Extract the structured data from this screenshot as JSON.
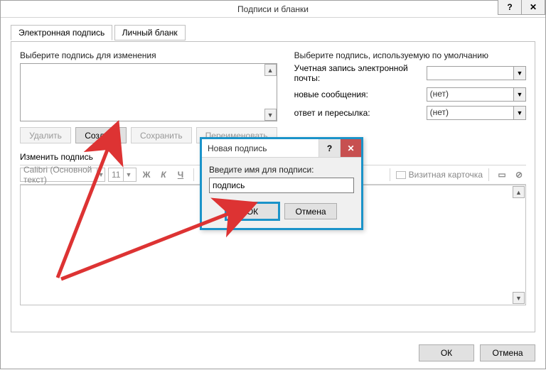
{
  "window": {
    "title": "Подписи и бланки"
  },
  "tabs": {
    "signature": "Электронная подпись",
    "blank": "Личный бланк"
  },
  "left": {
    "select_label": "Выберите подпись для изменения",
    "delete": "Удалить",
    "create": "Создать",
    "save": "Сохранить",
    "rename": "Переименовать"
  },
  "right": {
    "default_label": "Выберите подпись, используемую по умолчанию",
    "account_label": "Учетная запись электронной почты:",
    "account_value": "",
    "new_msg_label": "новые сообщения:",
    "new_msg_value": "(нет)",
    "reply_label": "ответ и пересылка:",
    "reply_value": "(нет)"
  },
  "edit": {
    "section_label": "Изменить подпись",
    "font": "Calibri (Основной текст)",
    "size": "11",
    "bold": "Ж",
    "italic": "К",
    "underline": "Ч",
    "bizcard": "Визитная карточка"
  },
  "footer": {
    "ok": "ОК",
    "cancel": "Отмена"
  },
  "modal": {
    "title": "Новая подпись",
    "prompt": "Введите имя для подписи:",
    "value": "подпись",
    "ok": "ОК",
    "cancel": "Отмена"
  }
}
